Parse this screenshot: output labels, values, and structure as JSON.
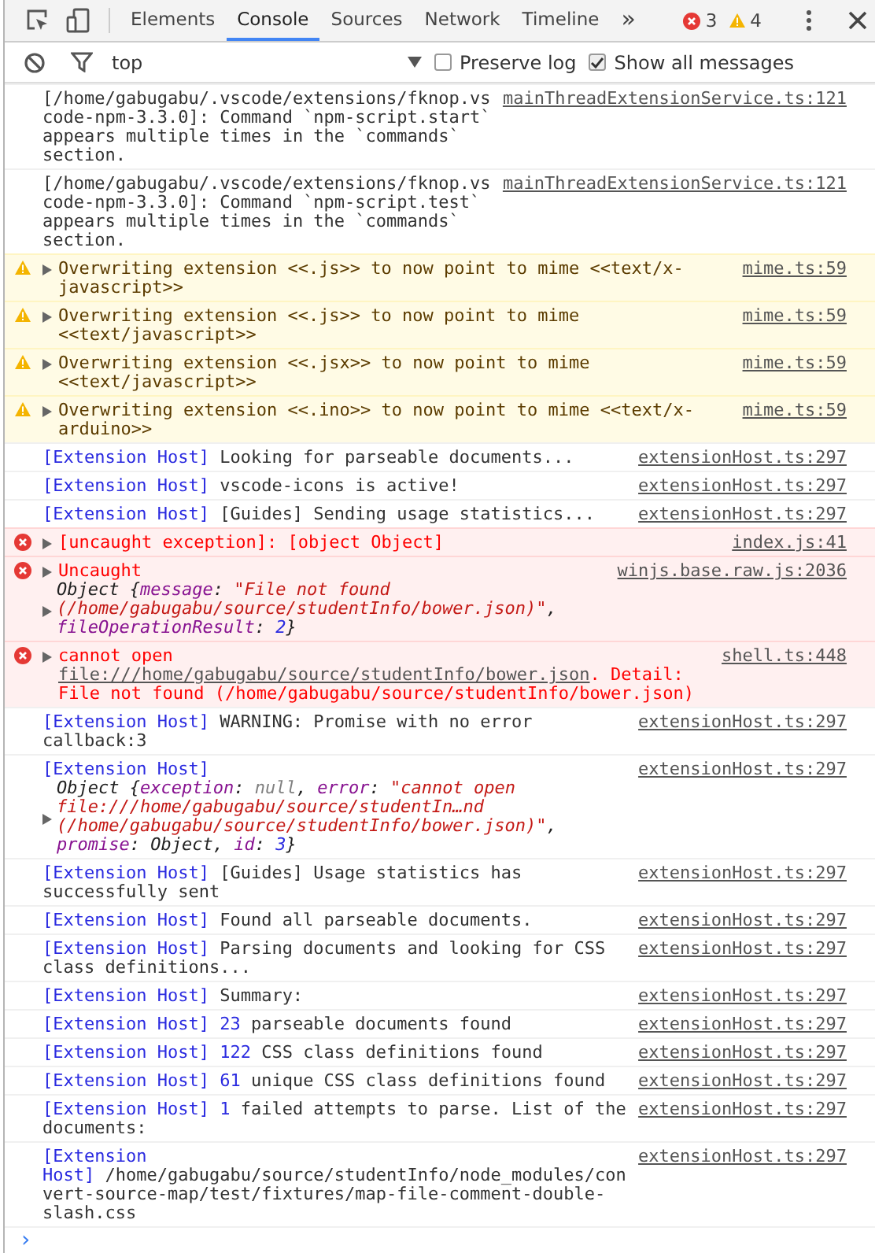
{
  "toolbar": {
    "tabs": [
      {
        "label": "Elements",
        "selected": false
      },
      {
        "label": "Console",
        "selected": true
      },
      {
        "label": "Sources",
        "selected": false
      },
      {
        "label": "Network",
        "selected": false
      },
      {
        "label": "Timeline",
        "selected": false
      }
    ],
    "more": "»",
    "error_count": "3",
    "warning_count": "4"
  },
  "filter_bar": {
    "context": "top",
    "options": [
      {
        "label": "Preserve log",
        "checked": false
      },
      {
        "label": "Show all messages",
        "checked": true
      }
    ]
  },
  "messages": [
    {
      "kind": "log",
      "disclosure": false,
      "source": "mainThreadExtensionService.ts:121",
      "parts": [
        {
          "kind": "text",
          "text": "[/home/gabugabu/.vscode/extensions/fknop.vscode-npm-3.3.0]: Command `npm-script.start` appears multiple times in the `commands` section."
        }
      ]
    },
    {
      "kind": "log",
      "disclosure": false,
      "source": "mainThreadExtensionService.ts:121",
      "parts": [
        {
          "kind": "text",
          "text": "[/home/gabugabu/.vscode/extensions/fknop.vscode-npm-3.3.0]: Command `npm-script.test` appears multiple times in the `commands` section."
        }
      ]
    },
    {
      "kind": "warning",
      "disclosure": true,
      "source": "mime.ts:59",
      "parts": [
        {
          "kind": "text",
          "text": "Overwriting extension <<.js>> to now point to mime <<text/x-javascript>>"
        }
      ]
    },
    {
      "kind": "warning",
      "disclosure": true,
      "source": "mime.ts:59",
      "parts": [
        {
          "kind": "text",
          "text": "Overwriting extension <<.js>> to now point to mime <<text/javascript>>"
        }
      ]
    },
    {
      "kind": "warning",
      "disclosure": true,
      "source": "mime.ts:59",
      "parts": [
        {
          "kind": "text",
          "text": "Overwriting extension <<.jsx>> to now point to mime <<text/javascript>>"
        }
      ]
    },
    {
      "kind": "warning",
      "disclosure": true,
      "source": "mime.ts:59",
      "parts": [
        {
          "kind": "text",
          "text": "Overwriting extension <<.ino>> to now point to mime <<text/x-arduino>>"
        }
      ]
    },
    {
      "kind": "log",
      "disclosure": false,
      "source": "extensionHost.ts:297",
      "prefix": "[Extension Host]",
      "parts": [
        {
          "kind": "text",
          "text": "Looking for parseable documents..."
        }
      ]
    },
    {
      "kind": "log",
      "disclosure": false,
      "source": "extensionHost.ts:297",
      "prefix": "[Extension Host]",
      "parts": [
        {
          "kind": "text",
          "text": "vscode-icons is active!"
        }
      ]
    },
    {
      "kind": "log",
      "disclosure": false,
      "source": "extensionHost.ts:297",
      "prefix": "[Extension Host]",
      "parts": [
        {
          "kind": "text",
          "text": "[Guides] Sending usage statistics..."
        }
      ]
    },
    {
      "kind": "error",
      "disclosure": true,
      "source": "index.js:41",
      "parts": [
        {
          "kind": "text",
          "text": "[uncaught exception]: [object Object]"
        }
      ]
    },
    {
      "kind": "error",
      "disclosure": true,
      "source": "winjs.base.raw.js:2036",
      "parts": [
        {
          "kind": "text",
          "text": "Uncaught"
        }
      ],
      "object": {
        "disclosure": true,
        "parts": [
          {
            "kind": "text",
            "text": "Object {"
          },
          {
            "kind": "key",
            "text": "message"
          },
          {
            "kind": "text",
            "text": ": "
          },
          {
            "kind": "string",
            "text": "\"File not found (/home/gabugabu/source/studentInfo/bower.json)\""
          },
          {
            "kind": "text",
            "text": ", "
          },
          {
            "kind": "key",
            "text": "fileOperationResult"
          },
          {
            "kind": "text",
            "text": ": "
          },
          {
            "kind": "number",
            "text": "2"
          },
          {
            "kind": "text",
            "text": "}"
          }
        ]
      }
    },
    {
      "kind": "error",
      "disclosure": true,
      "source": "shell.ts:448",
      "parts": [
        {
          "kind": "text",
          "text": "cannot open "
        },
        {
          "kind": "link",
          "text": "file:///home/gabugabu/source/studentInfo/bower.json"
        },
        {
          "kind": "text",
          "text": ". Detail: File not found (/home/gabugabu/source/studentInfo/bower.json)"
        }
      ]
    },
    {
      "kind": "log",
      "disclosure": false,
      "source": "extensionHost.ts:297",
      "prefix": "[Extension Host]",
      "parts": [
        {
          "kind": "text",
          "text": "WARNING: Promise with no error callback:3"
        }
      ]
    },
    {
      "kind": "log",
      "disclosure": false,
      "source": "extensionHost.ts:297",
      "prefix": "[Extension Host]",
      "object": {
        "disclosure": true,
        "parts": [
          {
            "kind": "text",
            "text": "Object {"
          },
          {
            "kind": "key",
            "text": "exception"
          },
          {
            "kind": "text",
            "text": ": "
          },
          {
            "kind": "null",
            "text": "null"
          },
          {
            "kind": "text",
            "text": ", "
          },
          {
            "kind": "key",
            "text": "error"
          },
          {
            "kind": "text",
            "text": ": "
          },
          {
            "kind": "string",
            "text": "\"cannot open file:///home/gabugabu/source/studentIn…nd (/home/gabugabu/source/studentInfo/bower.json)\""
          },
          {
            "kind": "text",
            "text": ", "
          },
          {
            "kind": "key",
            "text": "promise"
          },
          {
            "kind": "text",
            "text": ": Object, "
          },
          {
            "kind": "key",
            "text": "id"
          },
          {
            "kind": "text",
            "text": ": "
          },
          {
            "kind": "number",
            "text": "3"
          },
          {
            "kind": "text",
            "text": "}"
          }
        ]
      }
    },
    {
      "kind": "log",
      "disclosure": false,
      "source": "extensionHost.ts:297",
      "prefix": "[Extension Host]",
      "parts": [
        {
          "kind": "text",
          "text": "[Guides] Usage statistics has successfully sent"
        }
      ]
    },
    {
      "kind": "log",
      "disclosure": false,
      "source": "extensionHost.ts:297",
      "prefix": "[Extension Host]",
      "parts": [
        {
          "kind": "text",
          "text": "Found all parseable documents."
        }
      ]
    },
    {
      "kind": "log",
      "disclosure": false,
      "source": "extensionHost.ts:297",
      "prefix": "[Extension Host]",
      "parts": [
        {
          "kind": "text",
          "text": "Parsing documents and looking for CSS class definitions..."
        }
      ]
    },
    {
      "kind": "log",
      "disclosure": false,
      "source": "extensionHost.ts:297",
      "prefix": "[Extension Host]",
      "parts": [
        {
          "kind": "text",
          "text": "Summary:"
        }
      ]
    },
    {
      "kind": "log",
      "disclosure": false,
      "source": "extensionHost.ts:297",
      "prefix": "[Extension Host]",
      "parts": [
        {
          "kind": "number",
          "text": "23"
        },
        {
          "kind": "text",
          "text": " parseable documents found"
        }
      ]
    },
    {
      "kind": "log",
      "disclosure": false,
      "source": "extensionHost.ts:297",
      "prefix": "[Extension Host]",
      "parts": [
        {
          "kind": "number",
          "text": "122"
        },
        {
          "kind": "text",
          "text": " CSS class definitions found"
        }
      ]
    },
    {
      "kind": "log",
      "disclosure": false,
      "source": "extensionHost.ts:297",
      "prefix": "[Extension Host]",
      "parts": [
        {
          "kind": "number",
          "text": "61"
        },
        {
          "kind": "text",
          "text": " unique CSS class definitions found"
        }
      ]
    },
    {
      "kind": "log",
      "disclosure": false,
      "source": "extensionHost.ts:297",
      "prefix": "[Extension Host]",
      "parts": [
        {
          "kind": "number",
          "text": "1"
        },
        {
          "kind": "text",
          "text": " failed attempts to parse. List of the documents:"
        }
      ]
    },
    {
      "kind": "log",
      "disclosure": false,
      "source": "extensionHost.ts:297",
      "prefix": "[Extension Host]",
      "parts": [
        {
          "kind": "text",
          "text": "/home/gabugabu/source/studentInfo/node_modules/convert-source-map/test/fixtures/map-file-comment-double-slash.css"
        }
      ]
    }
  ],
  "prompt": "›"
}
